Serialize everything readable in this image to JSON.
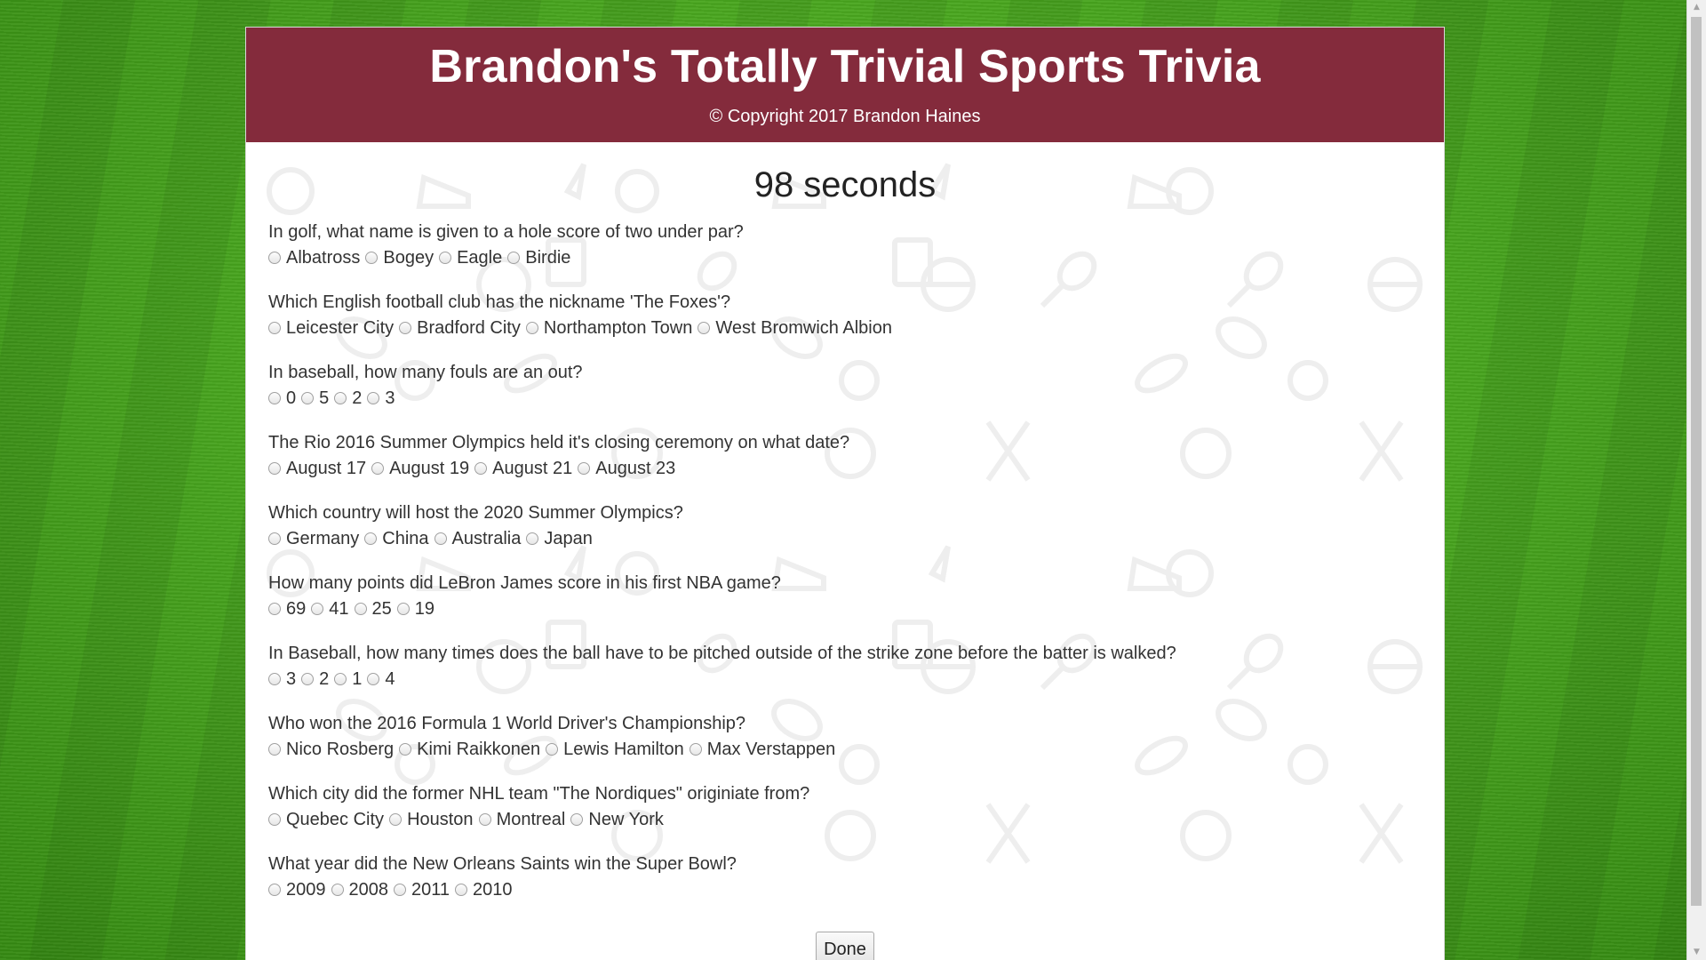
{
  "header": {
    "title": "Brandon's Totally Trivial Sports Trivia",
    "copyright": "© Copyright 2017 Brandon Haines"
  },
  "timer": "98 seconds",
  "questions": [
    {
      "text": "In golf, what name is given to a hole score of two under par?",
      "answers": [
        "Albatross",
        "Bogey",
        "Eagle",
        "Birdie"
      ]
    },
    {
      "text": "Which English football club has the nickname 'The Foxes'?",
      "answers": [
        "Leicester City",
        "Bradford City",
        "Northampton Town",
        "West Bromwich Albion"
      ]
    },
    {
      "text": "In baseball, how many fouls are an out?",
      "answers": [
        "0",
        "5",
        "2",
        "3"
      ]
    },
    {
      "text": "The Rio 2016 Summer Olympics held it's closing ceremony on what date?",
      "answers": [
        "August 17",
        "August 19",
        "August 21",
        "August 23"
      ]
    },
    {
      "text": "Which country will host the 2020 Summer Olympics?",
      "answers": [
        "Germany",
        "China",
        "Australia",
        "Japan"
      ]
    },
    {
      "text": "How many points did LeBron James score in his first NBA game?",
      "answers": [
        "69",
        "41",
        "25",
        "19"
      ]
    },
    {
      "text": "In Baseball, how many times does the ball have to be pitched outside of the strike zone before the batter is walked?",
      "answers": [
        "3",
        "2",
        "1",
        "4"
      ]
    },
    {
      "text": "Who won the 2016 Formula 1 World Driver's Championship?",
      "answers": [
        "Nico Rosberg",
        "Kimi Raikkonen",
        "Lewis Hamilton",
        "Max Verstappen"
      ]
    },
    {
      "text": "Which city did the former NHL team \"The Nordiques\" originiate from?",
      "answers": [
        "Quebec City",
        "Houston",
        "Montreal",
        "New York"
      ]
    },
    {
      "text": "What year did the New Orleans Saints win the Super Bowl?",
      "answers": [
        "2009",
        "2008",
        "2011",
        "2010"
      ]
    }
  ],
  "done_label": "Done",
  "colors": {
    "header_bg": "#842b3c",
    "background": "#4aa81f",
    "icon_pattern": "#f1f1f1"
  }
}
